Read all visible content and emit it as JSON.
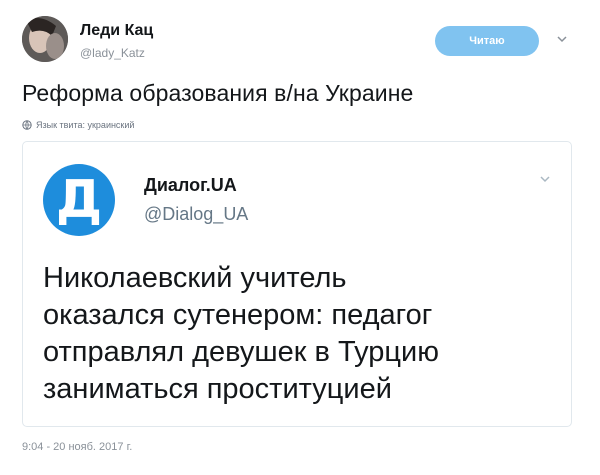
{
  "author": {
    "name": "Леди Кац",
    "handle": "@lady_Katz"
  },
  "follow_button": {
    "label": "Читаю"
  },
  "tweet": {
    "text": "Реформа образования в/на Украине",
    "language_note": "Язык твита: украинский",
    "timestamp": "9:04 - 20 нояб. 2017 г."
  },
  "quoted": {
    "logo_letter": "Д",
    "name": "Диалог.UA",
    "handle": "@Dialog_UA",
    "lines": [
      "Николаевский учитель",
      "оказался сутенером: педагог",
      "отправлял девушек в Турцию",
      "заниматься проституцией"
    ]
  },
  "colors": {
    "follow_button": "#80c3f0",
    "logo_background": "#1e8ddc",
    "card_border": "#e1e8ed"
  },
  "icons": [
    "avatar-photo",
    "chevron-down-icon",
    "globe-icon"
  ]
}
